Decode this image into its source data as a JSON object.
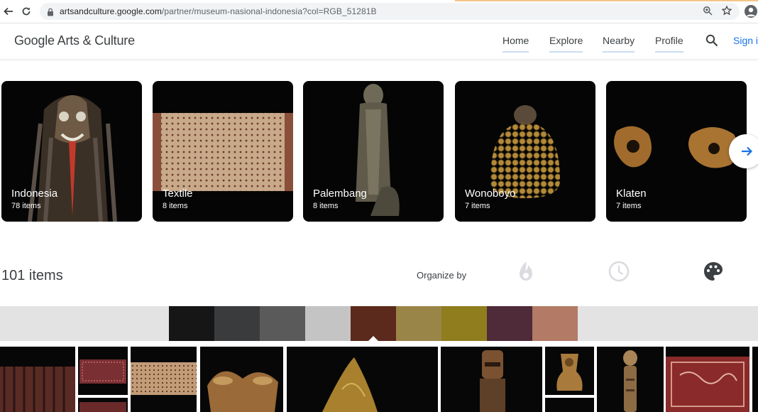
{
  "browser": {
    "url_host": "artsandculture.google.com",
    "url_path": "/partner/museum-nasional-indonesia?col=RGB_51281B"
  },
  "header": {
    "logo": "Google Arts & Culture",
    "nav": [
      {
        "label": "Home"
      },
      {
        "label": "Explore"
      },
      {
        "label": "Nearby"
      },
      {
        "label": "Profile"
      }
    ],
    "sign_in": "Sign in"
  },
  "collections": [
    {
      "title": "Indonesia",
      "count": "78 items"
    },
    {
      "title": "Textile",
      "count": "8 items"
    },
    {
      "title": "Palembang",
      "count": "8 items"
    },
    {
      "title": "Wonoboyo",
      "count": "7 items"
    },
    {
      "title": "Klaten",
      "count": "7 items"
    }
  ],
  "results": {
    "count": "101 items",
    "organize_label": "Organize by",
    "organize_options": [
      "popularity-icon",
      "time-icon",
      "color-icon"
    ]
  },
  "color_filter": {
    "swatches": [
      "#161616",
      "#3a3b3d",
      "#5a5a5a",
      "#c4c4c4",
      "#5b2a1c",
      "#9a8548",
      "#8f7d1e",
      "#4f2a38",
      "#b37a65"
    ],
    "selected_index": 4
  }
}
